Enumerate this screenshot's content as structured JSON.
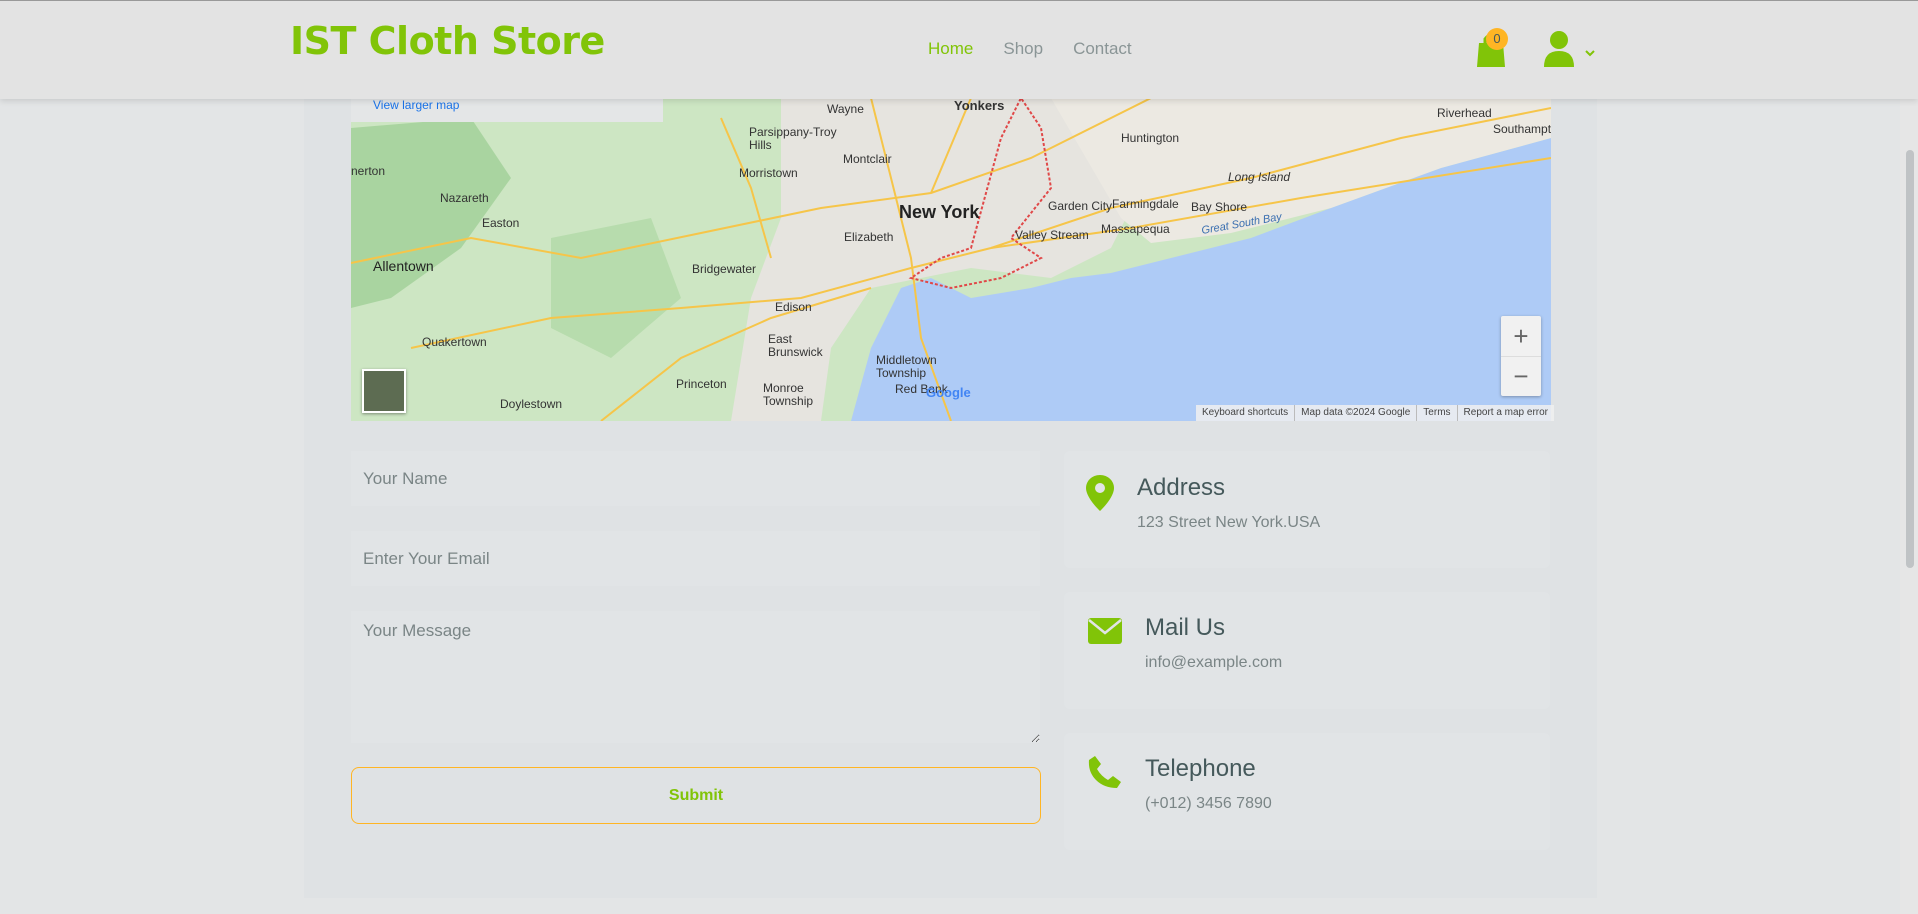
{
  "header": {
    "brand": "IST Cloth Store",
    "nav": [
      "Home",
      "Shop",
      "Contact"
    ],
    "cart_count": "0"
  },
  "map": {
    "larger_map_link": "View larger map",
    "zoom_in": "+",
    "zoom_out": "−",
    "footer": [
      "Keyboard shortcuts",
      "Map data ©2024 Google",
      "Terms",
      "Report a map error"
    ],
    "logo": "Google",
    "places": [
      "Yonkers",
      "Wayne",
      "Parsippany-Troy Hills",
      "Montclair",
      "Morristown",
      "Nazareth",
      "Easton",
      "Allentown",
      "Bridgewater",
      "Elizabeth",
      "New York",
      "Garden City",
      "Farmingdale",
      "Valley Stream",
      "Massapequa",
      "Huntington",
      "Riverhead",
      "Southampton",
      "Long Island",
      "Bay Shore",
      "Great South Bay",
      "Quakertown",
      "Doylestown",
      "Edison",
      "East Brunswick",
      "Middletown Township",
      "Princeton",
      "Monroe Township",
      "Red Bank",
      "nerton"
    ]
  },
  "form": {
    "name_placeholder": "Your Name",
    "email_placeholder": "Enter Your Email",
    "message_placeholder": "Your Message",
    "submit_label": "Submit"
  },
  "cards": [
    {
      "title": "Address",
      "value": "123 Street New York.USA",
      "icon": "map-pin-icon"
    },
    {
      "title": "Mail Us",
      "value": "info@example.com",
      "icon": "envelope-icon"
    },
    {
      "title": "Telephone",
      "value": "(+012) 3456 7890",
      "icon": "phone-icon"
    }
  ],
  "colors": {
    "accent": "#81c408",
    "secondary": "#ffb524",
    "text": "#45595b"
  }
}
